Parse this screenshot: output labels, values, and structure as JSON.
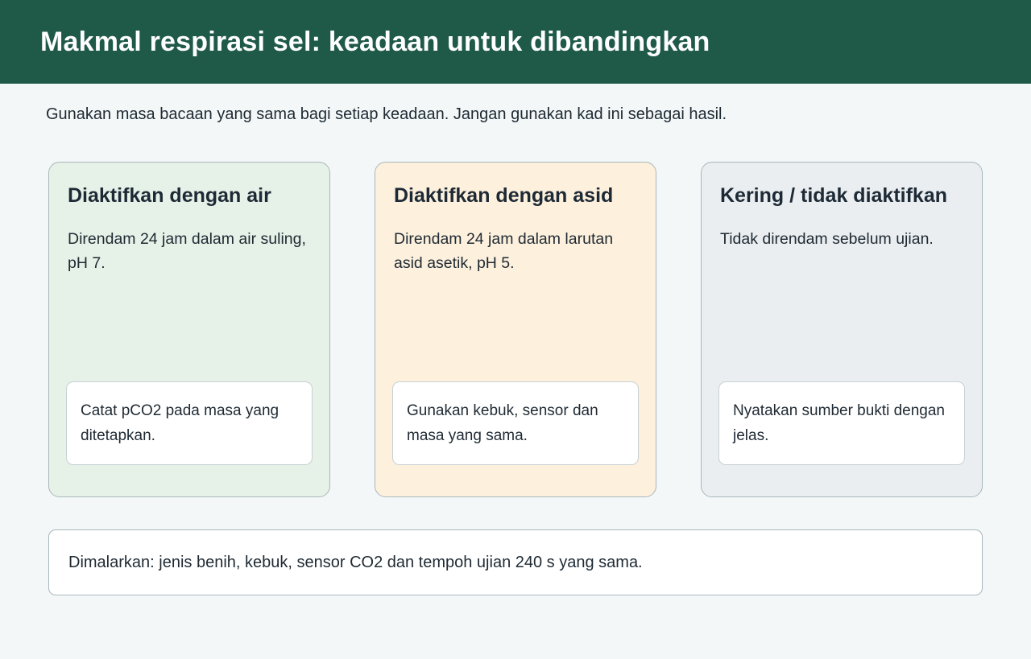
{
  "header": {
    "title": "Makmal respirasi sel: keadaan untuk dibandingkan"
  },
  "intro": "Gunakan masa bacaan yang sama bagi setiap keadaan. Jangan gunakan kad ini sebagai hasil.",
  "cards": [
    {
      "title": "Diaktifkan dengan air",
      "description": "Direndam 24 jam dalam air suling, pH 7.",
      "note": "Catat pCO2 pada masa yang ditetapkan.",
      "color": "#e6f1e8"
    },
    {
      "title": "Diaktifkan dengan asid",
      "description": "Direndam 24 jam dalam larutan asid asetik, pH 5.",
      "note": "Gunakan kebuk, sensor dan masa yang sama.",
      "color": "#fdf0dd"
    },
    {
      "title": "Kering / tidak diaktifkan",
      "description": "Tidak direndam sebelum ujian.",
      "note": "Nyatakan sumber bukti dengan jelas.",
      "color": "#eaeef1"
    }
  ],
  "footer": "Dimalarkan: jenis benih, kebuk, sensor CO2 dan tempoh ujian 240 s yang sama.",
  "colors": {
    "header_bg": "#1f5a48",
    "page_bg": "#f3f7f8"
  }
}
